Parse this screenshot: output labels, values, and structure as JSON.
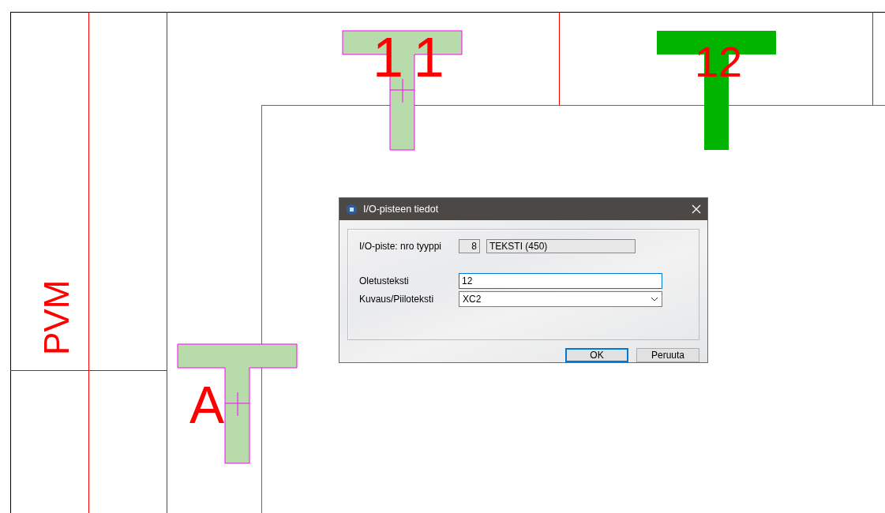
{
  "canvas": {
    "labels": [
      {
        "text": "PVM",
        "kind": "vertical"
      },
      {
        "text": "11",
        "kind": "spaced"
      },
      {
        "text": "12",
        "kind": "plain"
      },
      {
        "text": "A",
        "kind": "plain"
      }
    ],
    "symbols": [
      {
        "highlighted": false
      },
      {
        "highlighted": true
      },
      {
        "highlighted": false
      }
    ]
  },
  "dialog": {
    "title": "I/O-pisteen tiedot",
    "io_point": {
      "label": "I/O-piste: nro tyyppi",
      "number": "8",
      "type": "TEKSTI (450)"
    },
    "default_text": {
      "label": "Oletusteksti",
      "value": "12"
    },
    "description": {
      "label": "Kuvaus/Piiloteksti",
      "value": "XC2"
    },
    "buttons": [
      {
        "label": "OK",
        "default": true
      },
      {
        "label": "Peruuta",
        "default": false
      }
    ]
  }
}
